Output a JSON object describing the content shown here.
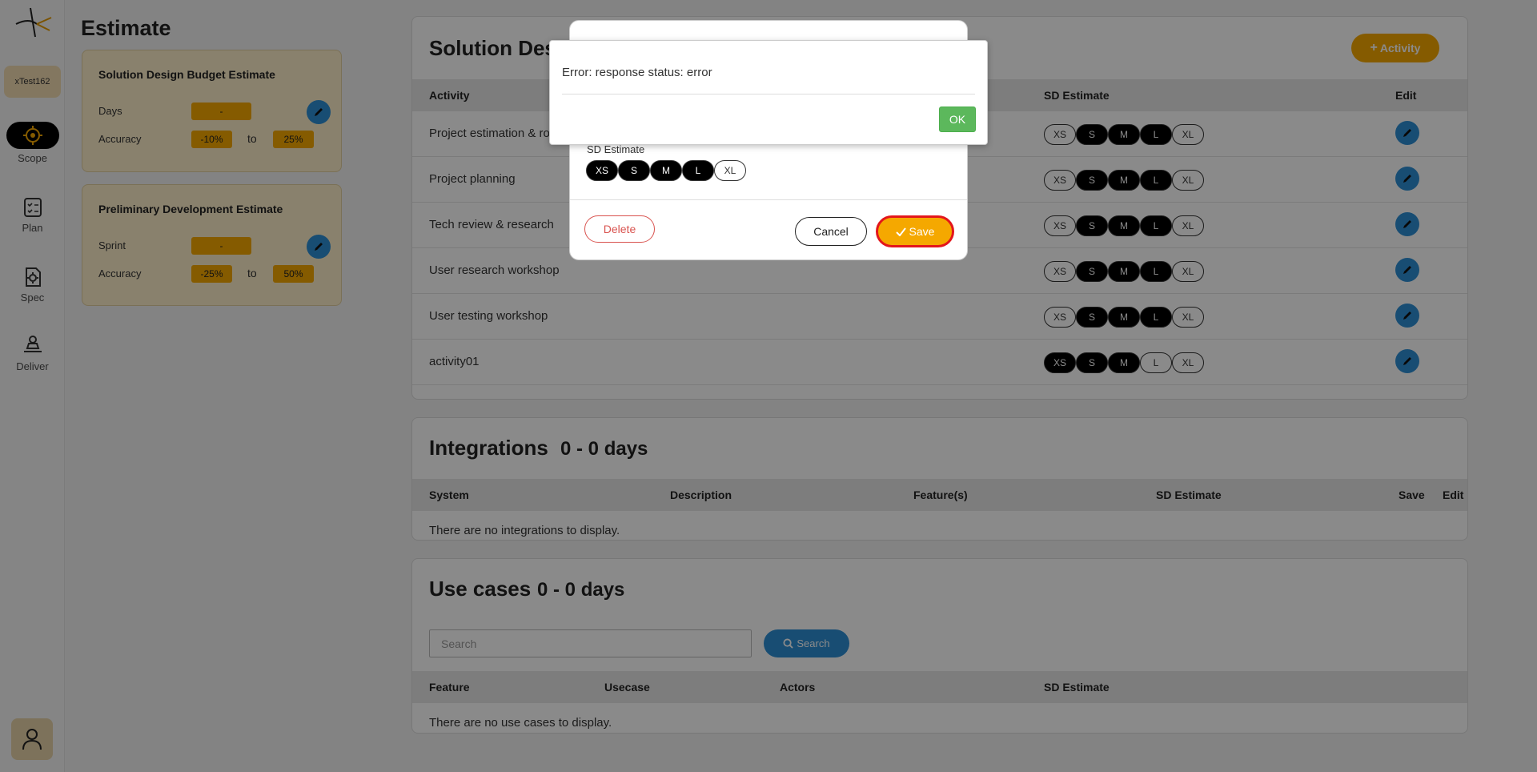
{
  "sidebar": {
    "project_chip": "xTest162",
    "nav": [
      {
        "label": "Scope",
        "icon": "target-icon"
      },
      {
        "label": "Plan",
        "icon": "checklist-icon"
      },
      {
        "label": "Spec",
        "icon": "gear-document-icon"
      },
      {
        "label": "Deliver",
        "icon": "person-laptop-icon"
      }
    ],
    "user_icon": "user-icon"
  },
  "page": {
    "title": "Estimate"
  },
  "budget_card": {
    "title": "Solution Design Budget Estimate",
    "days_label": "Days",
    "days_value": "-",
    "accuracy_label": "Accuracy",
    "accuracy_low": "-10%",
    "to": "to",
    "accuracy_high": "25%"
  },
  "dev_card": {
    "title": "Preliminary Development Estimate",
    "sprint_label": "Sprint",
    "sprint_value": "-",
    "accuracy_label": "Accuracy",
    "accuracy_low": "-25%",
    "to": "to",
    "accuracy_high": "50%"
  },
  "solution_design": {
    "title": "Solution Design",
    "add_button": "Activity",
    "columns": {
      "activity": "Activity",
      "sd_estimate": "SD Estimate",
      "edit": "Edit"
    },
    "size_labels": [
      "XS",
      "S",
      "M",
      "L",
      "XL"
    ],
    "rows": [
      {
        "name": "Project estimation & ro",
        "selected": [
          1,
          2,
          3
        ]
      },
      {
        "name": "Project planning",
        "selected": [
          1,
          2,
          3
        ]
      },
      {
        "name": "Tech review & research",
        "selected": [
          1,
          2,
          3
        ]
      },
      {
        "name": "User research workshop",
        "selected": [
          1,
          2,
          3
        ]
      },
      {
        "name": "User testing workshop",
        "selected": [
          1,
          2,
          3
        ]
      },
      {
        "name": "activity01",
        "selected": [
          0,
          1,
          2
        ]
      }
    ]
  },
  "integrations": {
    "title": "Integrations",
    "range": "0 - 0 days",
    "columns": {
      "system": "System",
      "description": "Description",
      "features": "Feature(s)",
      "sd_estimate": "SD Estimate",
      "save": "Save",
      "edit": "Edit"
    },
    "empty": "There are no integrations to display."
  },
  "use_cases": {
    "title": "Use cases",
    "range": "0 - 0 days",
    "search_placeholder": "Search",
    "search_button": "Search",
    "columns": {
      "feature": "Feature",
      "usecase": "Usecase",
      "actors": "Actors",
      "sd_estimate": "SD Estimate"
    },
    "empty": "There are no use cases to display."
  },
  "edit_modal": {
    "sd_label": "SD Estimate",
    "size_labels": [
      "XS",
      "S",
      "M",
      "L",
      "XL"
    ],
    "selected": [
      0,
      1,
      2,
      3
    ],
    "delete": "Delete",
    "cancel": "Cancel",
    "save": "Save"
  },
  "alert": {
    "message": "Error: response status: error",
    "ok": "OK"
  },
  "colors": {
    "accent": "#f5a800",
    "edit_blue": "#2d8fd5",
    "ok_green": "#5cb85c",
    "danger": "#d9534f"
  }
}
